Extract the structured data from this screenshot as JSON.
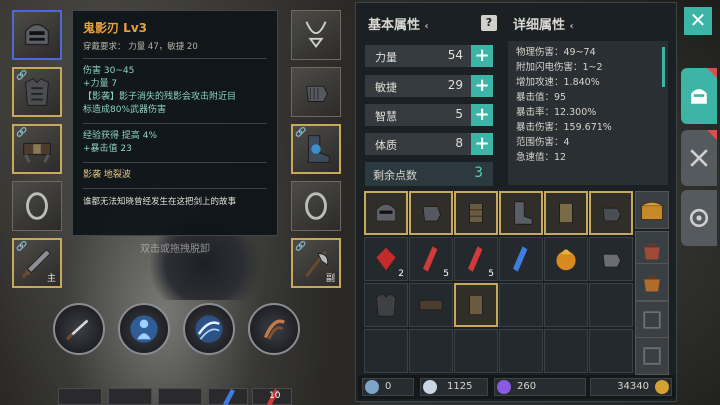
{
  "tooltip": {
    "item_name": "鬼影刃 Lv3",
    "requirement": "穿戴要求：      力量 47，敏捷 20",
    "damage": "伤害  30~45",
    "bonus_strength": "+力量 7",
    "shadow_effect_1": "【影袭】影子消失的残影会攻击附近目",
    "shadow_effect_2": "标造成80%武器伤害",
    "exp_bonus": "经验获得  提高 4%",
    "crit_bonus": "+暴击值 23",
    "skills": "影袭   地裂波",
    "lore": "谁都无法知晓曾经发生在这把剑上的故事"
  },
  "scene": {
    "hint_text": "双击或拖拽脱卸"
  },
  "equipment": {
    "left_slot_5_label": "主",
    "right_slot_5_label": "副"
  },
  "quickbar": {
    "potion_red_count": "10"
  },
  "basic_attributes": {
    "header": "基本属性",
    "arrow": "‹",
    "help": "?",
    "rows": [
      {
        "name": "力量",
        "value": "54"
      },
      {
        "name": "敏捷",
        "value": "29"
      },
      {
        "name": "智慧",
        "value": "5"
      },
      {
        "name": "体质",
        "value": "8"
      }
    ],
    "plus": "+",
    "remaining_label": "剩余点数",
    "remaining_value": "3"
  },
  "detail_attributes": {
    "header": "详细属性",
    "arrow": "‹",
    "lines": [
      "物理伤害：49~74",
      "附加闪电伤害：1~2",
      "增加攻速：1.840%",
      "暴击值：95",
      "暴击率：12.300%",
      "暴击伤害：159.671%",
      "范围伤害：4",
      "急速值：12"
    ]
  },
  "inventory": {
    "counts": {
      "r2c1": "2",
      "r2c2": "5",
      "r2c3": "5"
    }
  },
  "resources": {
    "keys": "0",
    "gems": "1125",
    "crystals": "260",
    "gold": "34340"
  },
  "controls": {
    "close": "✕"
  },
  "colors": {
    "accent": "#3cb5a6",
    "item_title": "#e8a13a",
    "gold_border": "#c8a85a"
  }
}
